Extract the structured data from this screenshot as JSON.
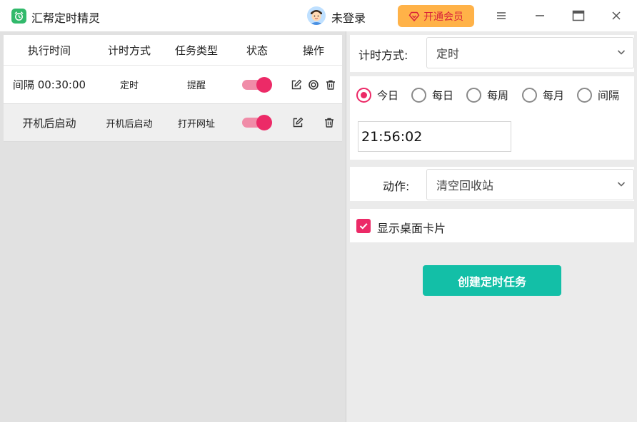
{
  "app": {
    "title": "汇帮定时精灵",
    "logo_icon": "alarm-clock-icon"
  },
  "header": {
    "login_text": "未登录",
    "vip_label": "开通会员",
    "vip_icon": "diamond-icon"
  },
  "colors": {
    "accent": "#ec2a67",
    "toggle_track": "#f08ca8",
    "vip_bg": "#ffb248",
    "create_button": "#13bfa7",
    "logo_green": "#31b96b"
  },
  "table": {
    "headers": [
      "执行时间",
      "计时方式",
      "任务类型",
      "状态",
      "操作"
    ],
    "rows": [
      {
        "time": "间隔 00:30:00",
        "method": "定时",
        "type": "提醒",
        "enabled": true,
        "actions": [
          "edit-icon",
          "target-icon",
          "trash-icon"
        ]
      },
      {
        "time": "开机后启动",
        "method": "开机后启动",
        "type": "打开网址",
        "enabled": true,
        "actions": [
          "edit-icon",
          "trash-icon"
        ]
      }
    ]
  },
  "form": {
    "timing_label": "计时方式:",
    "timing_value": "定时",
    "radios": [
      {
        "label": "今日",
        "checked": true
      },
      {
        "label": "每日",
        "checked": false
      },
      {
        "label": "每周",
        "checked": false
      },
      {
        "label": "每月",
        "checked": false
      },
      {
        "label": "间隔",
        "checked": false
      }
    ],
    "time_value": "21:56:02",
    "action_label": "动作:",
    "action_value": "清空回收站",
    "show_card_label": "显示桌面卡片",
    "show_card_checked": true,
    "create_button": "创建定时任务"
  }
}
